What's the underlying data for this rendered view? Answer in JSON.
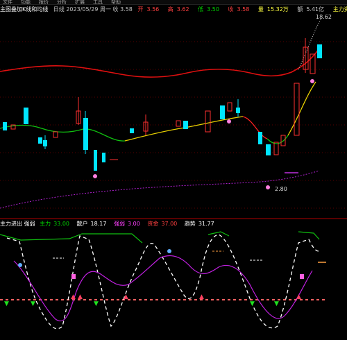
{
  "menu": {
    "items": [
      "文件",
      "功能",
      "报价",
      "分析",
      "扩展",
      "工具",
      "帮助"
    ]
  },
  "info_bar": {
    "title": "主图叠加K线和均线",
    "values": "日线 2023/05/29 周一 收 3.58",
    "fields": [
      {
        "label": "开",
        "value": "3.56",
        "color": "#ff4040"
      },
      {
        "label": "高",
        "value": "3.62",
        "color": "#ff4040"
      },
      {
        "label": "低",
        "value": "3.50",
        "color": "#00d000"
      },
      {
        "label": "收",
        "value": "3.58",
        "color": "#ff4040"
      },
      {
        "label": "量",
        "value": "15.32万",
        "color": "#ffff40"
      },
      {
        "label": "额",
        "value": "5.41亿",
        "color": "#cccccc"
      }
    ],
    "right_tag": "主力资金 监控"
  },
  "main_chart": {
    "price_top_label": "18.62",
    "low_marker_label": "2.80",
    "accent_up": "#ff3030",
    "accent_down": "#00e5ff"
  },
  "sub_chart": {
    "name": "主力进出 强弱",
    "fields": [
      {
        "label": "主力",
        "value": "33.00",
        "color": "#00d000"
      },
      {
        "label": "散户",
        "value": "18.17",
        "color": "#ffffff"
      },
      {
        "label": "强弱",
        "value": "3.00",
        "color": "#ff40ff"
      },
      {
        "label": "资金",
        "value": "37.00",
        "color": "#ff4040"
      },
      {
        "label": "趋势",
        "value": "31.77",
        "color": "#ffffff"
      }
    ]
  }
}
